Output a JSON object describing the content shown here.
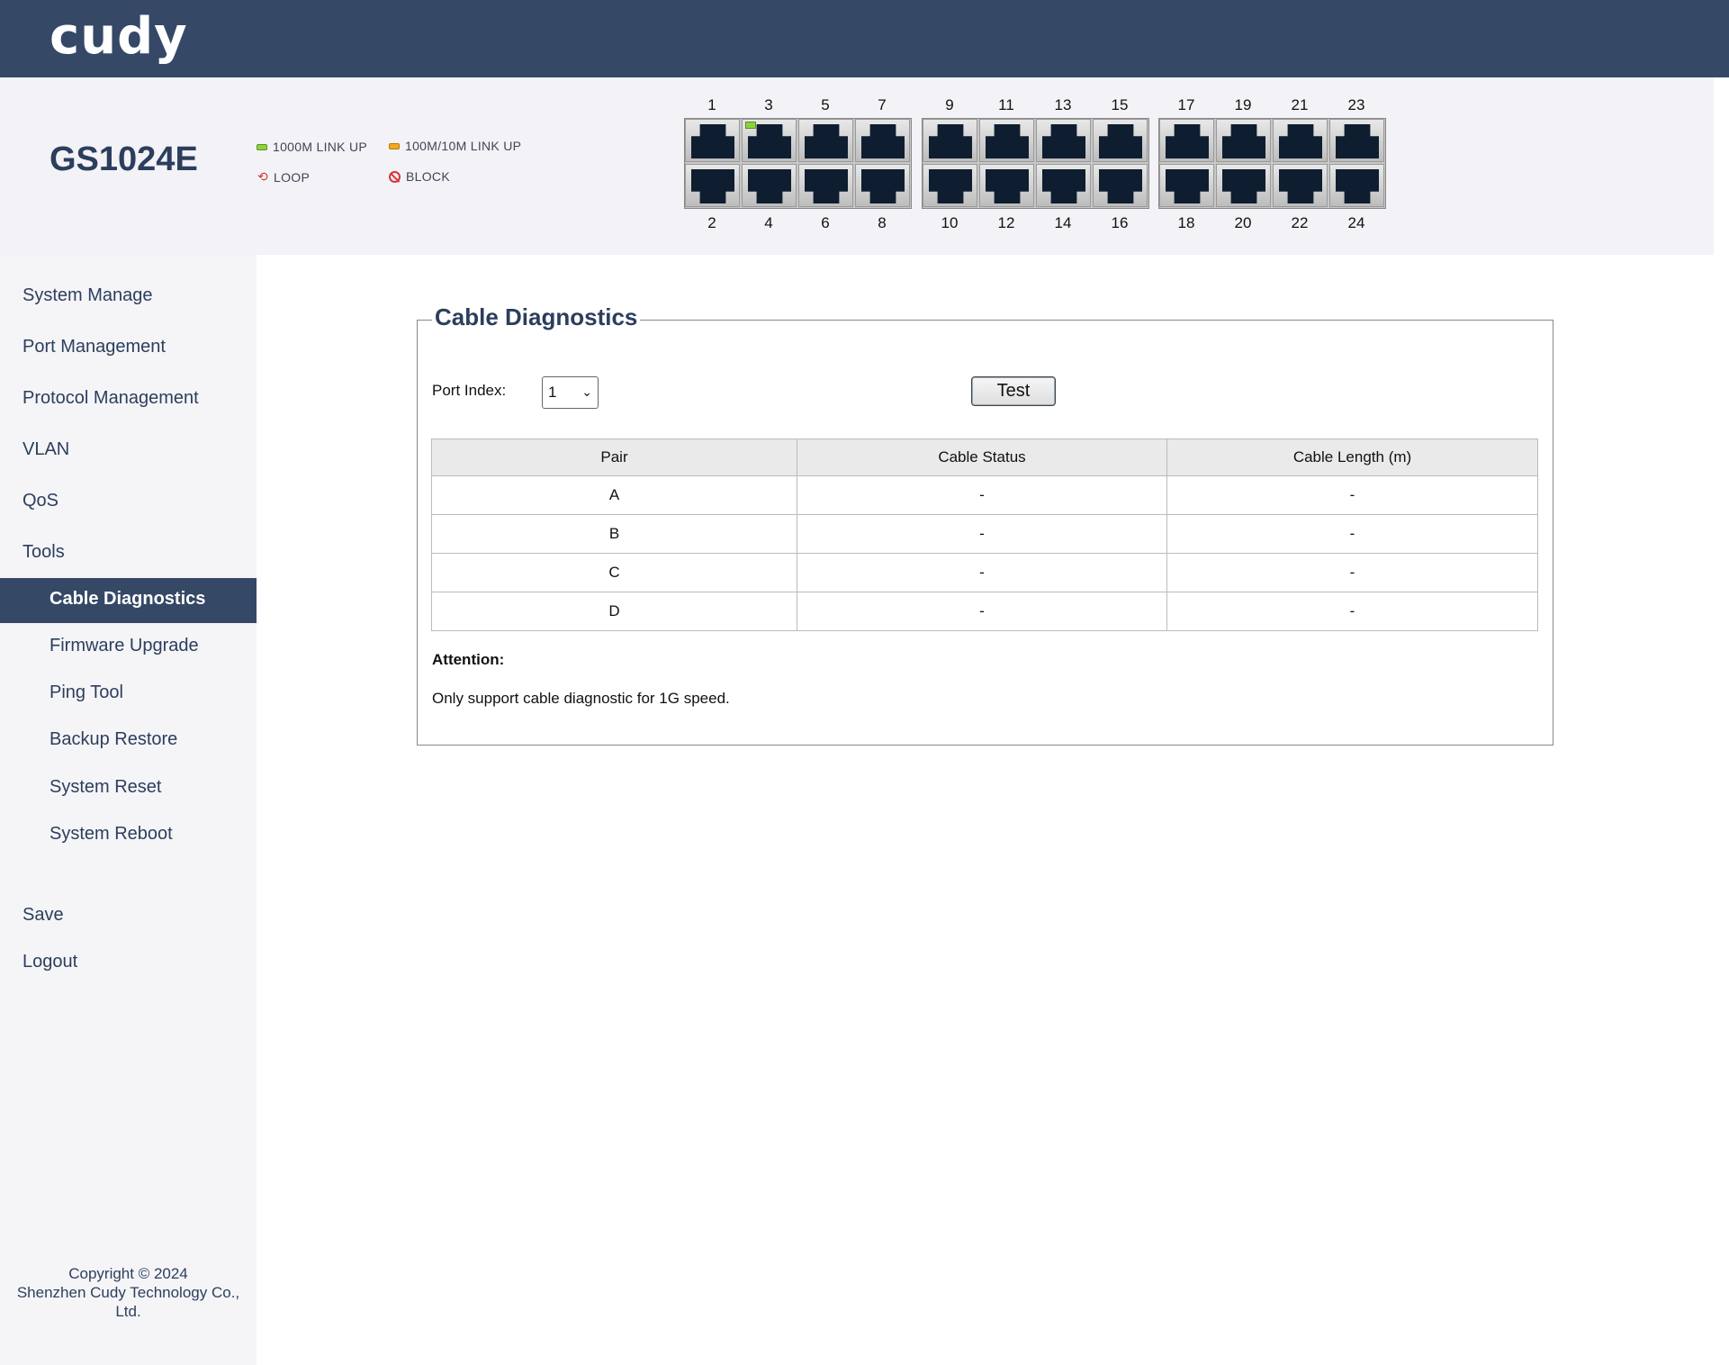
{
  "header": {
    "logo": "cudy"
  },
  "device": {
    "model": "GS1024E",
    "legend": {
      "link1000": "1000M LINK UP",
      "link100": "100M/10M LINK UP",
      "loop": "LOOP",
      "block": "BLOCK"
    },
    "ports_top": [
      "1",
      "3",
      "5",
      "7",
      "9",
      "11",
      "13",
      "15",
      "17",
      "19",
      "21",
      "23"
    ],
    "ports_bottom": [
      "2",
      "4",
      "6",
      "8",
      "10",
      "12",
      "14",
      "16",
      "18",
      "20",
      "22",
      "24"
    ],
    "active_ports": [
      "3"
    ]
  },
  "sidebar": {
    "items": [
      "System Manage",
      "Port Management",
      "Protocol Management",
      "VLAN",
      "QoS",
      "Tools"
    ],
    "tools_sub": [
      "Cable Diagnostics",
      "Firmware Upgrade",
      "Ping Tool",
      "Backup Restore",
      "System Reset",
      "System Reboot"
    ],
    "active": "Cable Diagnostics",
    "save": "Save",
    "logout": "Logout",
    "copyright_line1": "Copyright © 2024",
    "copyright_line2": "Shenzhen Cudy Technology Co.,",
    "copyright_line3": "Ltd."
  },
  "main": {
    "title": "Cable Diagnostics",
    "port_index_label": "Port Index:",
    "port_index_value": "1",
    "test_button": "Test",
    "table": {
      "headers": [
        "Pair",
        "Cable Status",
        "Cable Length (m)"
      ],
      "rows": [
        [
          "A",
          "-",
          "-"
        ],
        [
          "B",
          "-",
          "-"
        ],
        [
          "C",
          "-",
          "-"
        ],
        [
          "D",
          "-",
          "-"
        ]
      ]
    },
    "attention_label": "Attention:",
    "attention_text": "Only support cable diagnostic for 1G speed."
  }
}
